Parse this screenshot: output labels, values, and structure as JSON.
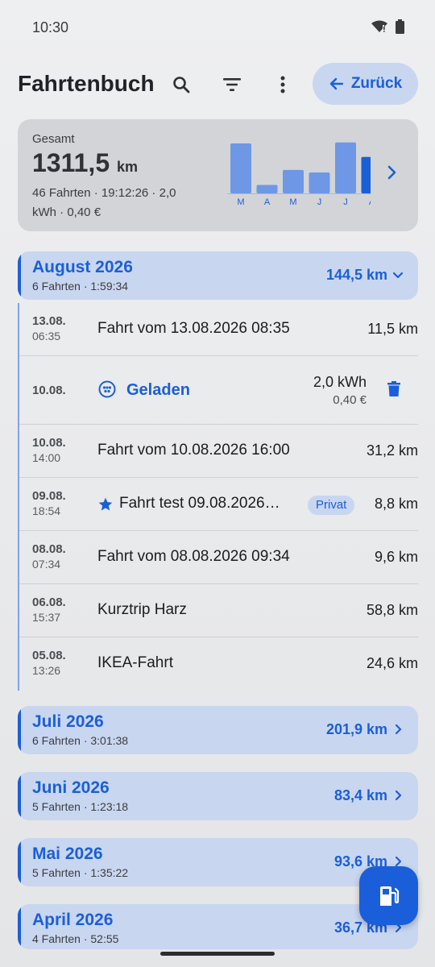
{
  "status": {
    "time": "10:30"
  },
  "header": {
    "title": "Fahrtenbuch",
    "back_label": "Zurück"
  },
  "summary": {
    "label": "Gesamt",
    "total": "1311,5",
    "total_unit": "km",
    "details": "46 Fahrten · 19:12:26 · 2,0 kWh · 0,40 €",
    "chart": {
      "months": [
        "M",
        "A",
        "M",
        "J",
        "J",
        "A"
      ],
      "values": [
        1.0,
        0.17,
        0.47,
        0.42,
        1.02,
        0.73
      ],
      "highlight_index": 5
    }
  },
  "months": [
    {
      "title": "August 2026",
      "sub": "6 Fahrten · 1:59:34",
      "km": "144,5 km",
      "expanded": true,
      "entries": [
        {
          "type": "trip",
          "date": "13.08.",
          "time": "06:35",
          "title": "Fahrt vom 13.08.2026 08:35",
          "km": "11,5 km"
        },
        {
          "type": "charge",
          "date": "10.08.",
          "label": "Geladen",
          "kwh": "2,0 kWh",
          "cost": "0,40 €"
        },
        {
          "type": "trip",
          "date": "10.08.",
          "time": "14:00",
          "title": "Fahrt vom 10.08.2026 16:00",
          "km": "31,2 km"
        },
        {
          "type": "trip",
          "date": "09.08.",
          "time": "18:54",
          "title": "Fahrt test 09.08.2026…",
          "km": "8,8 km",
          "starred": true,
          "badge": "Privat"
        },
        {
          "type": "trip",
          "date": "08.08.",
          "time": "07:34",
          "title": "Fahrt vom 08.08.2026 09:34",
          "km": "9,6 km"
        },
        {
          "type": "trip",
          "date": "06.08.",
          "time": "15:37",
          "title": "Kurztrip Harz",
          "km": "58,8 km"
        },
        {
          "type": "trip",
          "date": "05.08.",
          "time": "13:26",
          "title": "IKEA-Fahrt",
          "km": "24,6 km"
        }
      ]
    },
    {
      "title": "Juli 2026",
      "sub": "6 Fahrten · 3:01:38",
      "km": "201,9 km",
      "expanded": false
    },
    {
      "title": "Juni 2026",
      "sub": "5 Fahrten · 1:23:18",
      "km": "83,4 km",
      "expanded": false
    },
    {
      "title": "Mai 2026",
      "sub": "5 Fahrten · 1:35:22",
      "km": "93,6 km",
      "expanded": false
    },
    {
      "title": "April 2026",
      "sub": "4 Fahrten · 52:55",
      "km": "36,7 km",
      "expanded": false
    }
  ],
  "colors": {
    "accent": "#1a5fd9",
    "accent_light": "#c9d6f0",
    "bar": "#6e97e6"
  }
}
